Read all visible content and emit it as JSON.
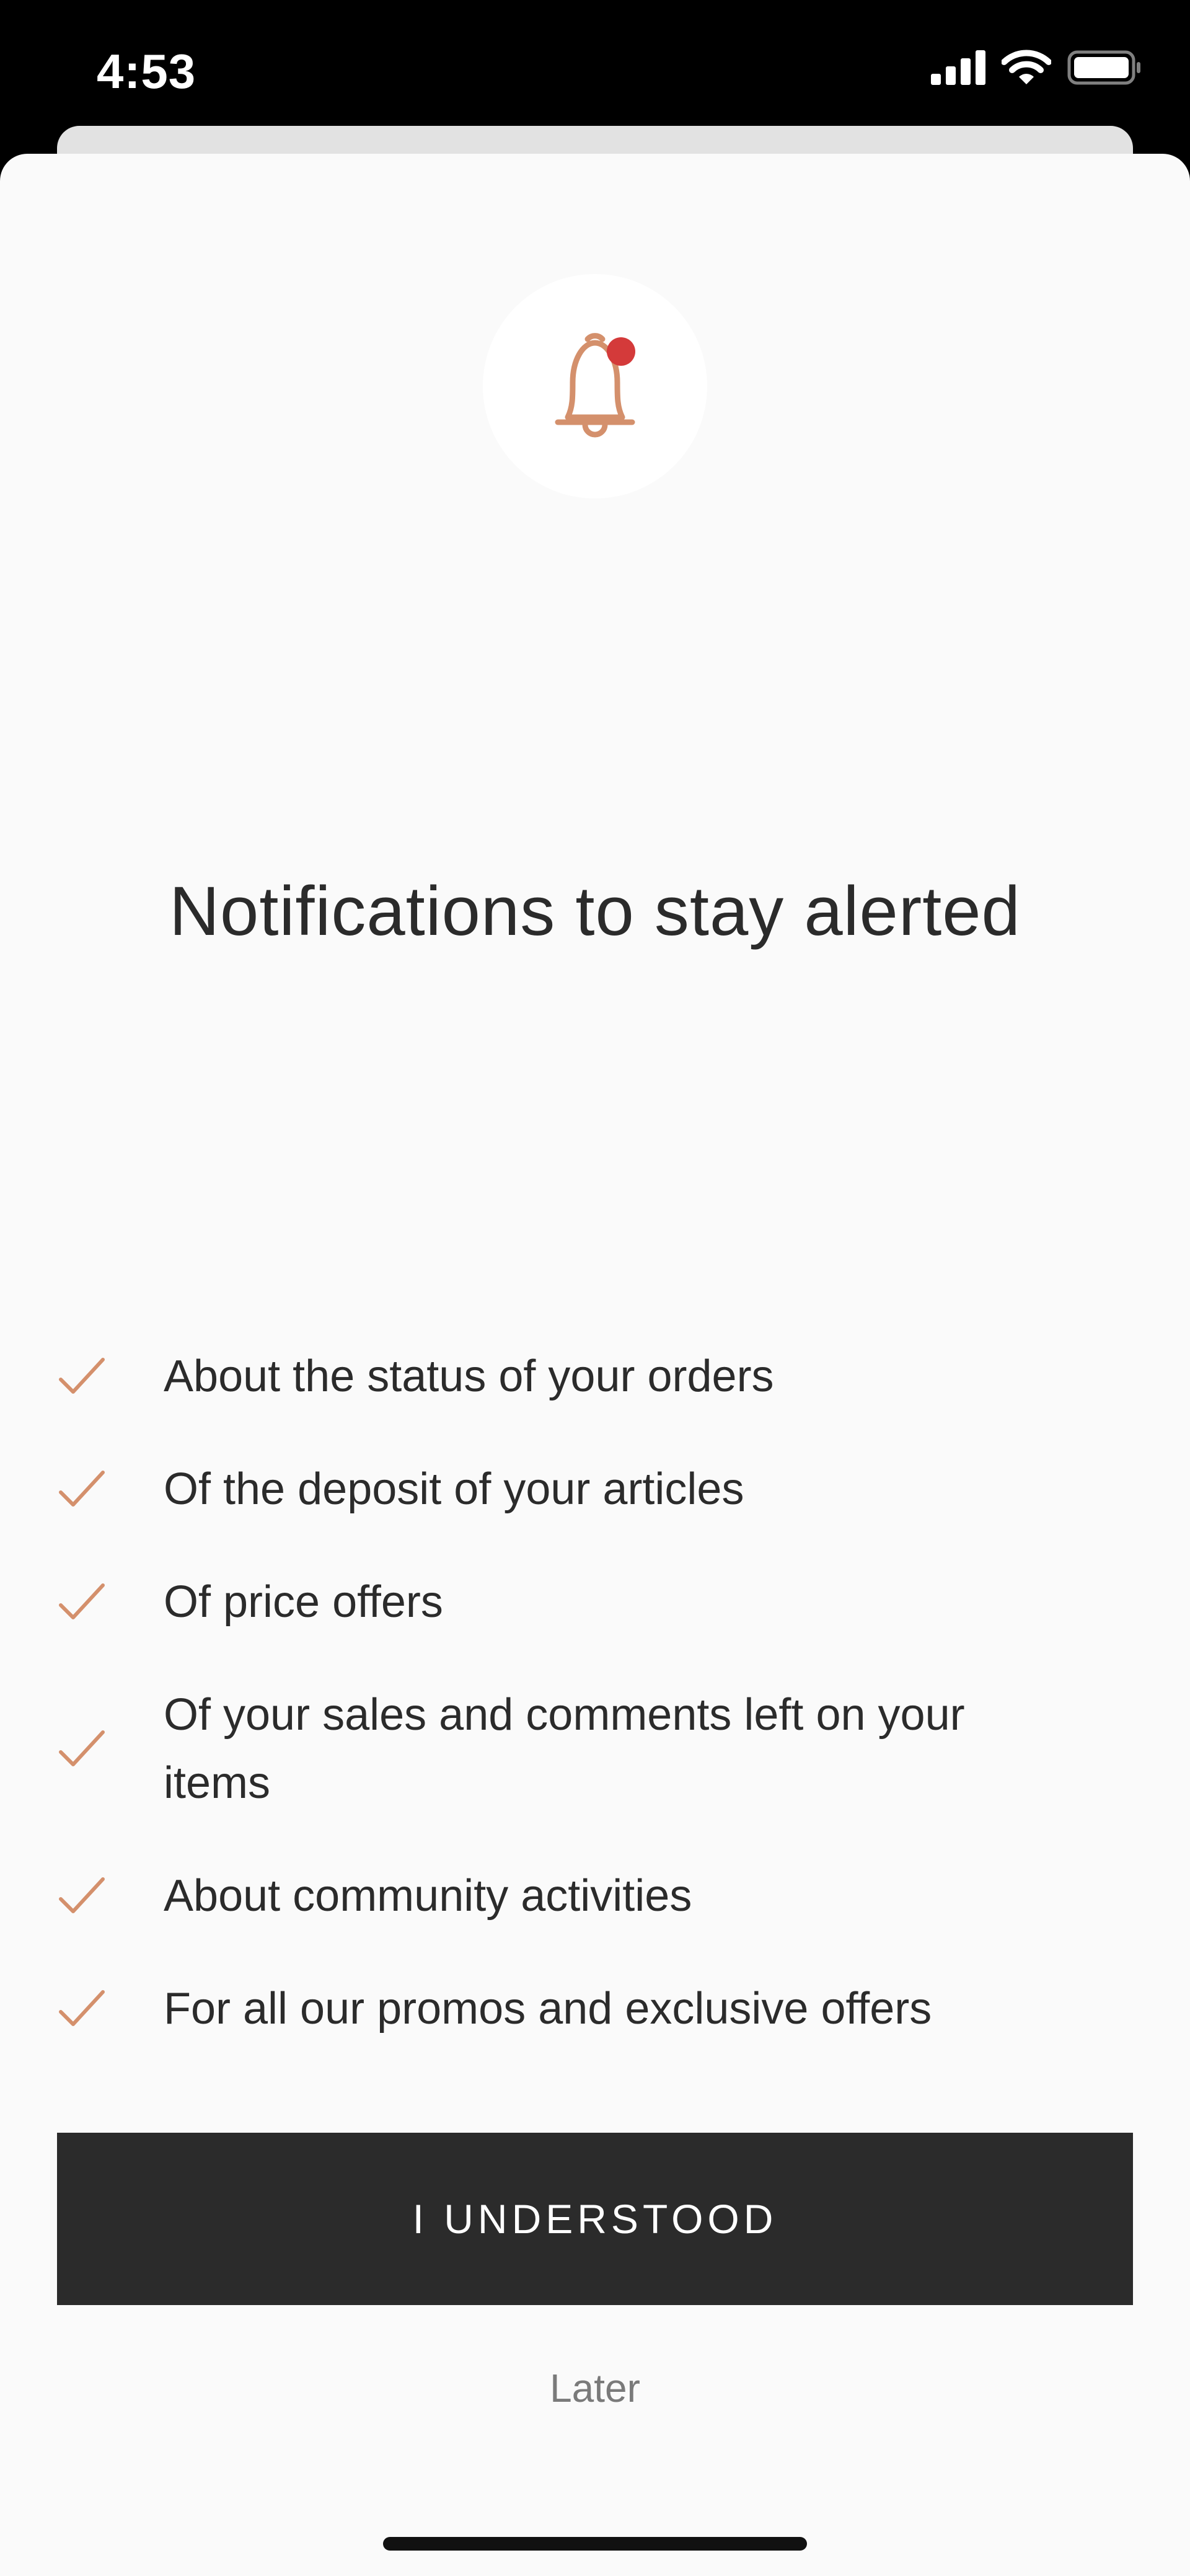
{
  "status_bar": {
    "time": "4:53"
  },
  "sheet": {
    "icon": "bell-with-red-dot-icon",
    "title": "Notifications to stay alerted",
    "benefits": [
      "About the status of your orders",
      "Of the deposit of your articles",
      "Of price offers",
      "Of your sales and comments left on your items",
      "About community activities",
      "For all our promos and exclusive offers"
    ],
    "primary_button_label": "I UNDERSTOOD",
    "secondary_link_label": "Later"
  },
  "colors": {
    "accent": "#d4906c",
    "notification_dot": "#d43a3a",
    "button_background": "#2b2b2b",
    "sheet_background": "#fafafa"
  }
}
